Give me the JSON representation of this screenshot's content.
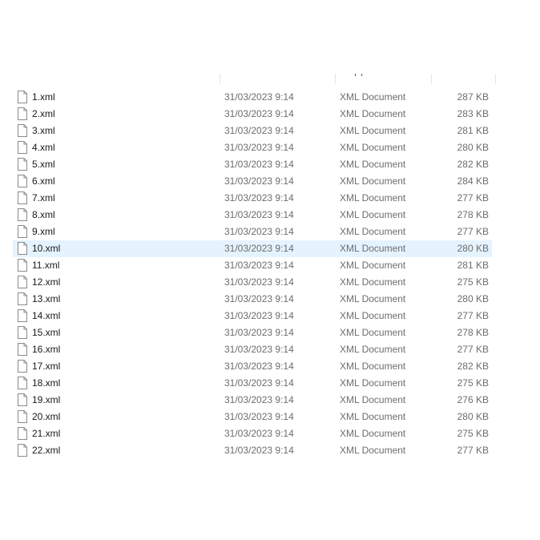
{
  "header": {
    "type_fragment": "ı ı"
  },
  "files": [
    {
      "name": "1.xml",
      "date": "31/03/2023 9:14",
      "type": "XML Document",
      "size": "287 KB",
      "selected": false
    },
    {
      "name": "2.xml",
      "date": "31/03/2023 9:14",
      "type": "XML Document",
      "size": "283 KB",
      "selected": false
    },
    {
      "name": "3.xml",
      "date": "31/03/2023 9:14",
      "type": "XML Document",
      "size": "281 KB",
      "selected": false
    },
    {
      "name": "4.xml",
      "date": "31/03/2023 9:14",
      "type": "XML Document",
      "size": "280 KB",
      "selected": false
    },
    {
      "name": "5.xml",
      "date": "31/03/2023 9:14",
      "type": "XML Document",
      "size": "282 KB",
      "selected": false
    },
    {
      "name": "6.xml",
      "date": "31/03/2023 9:14",
      "type": "XML Document",
      "size": "284 KB",
      "selected": false
    },
    {
      "name": "7.xml",
      "date": "31/03/2023 9:14",
      "type": "XML Document",
      "size": "277 KB",
      "selected": false
    },
    {
      "name": "8.xml",
      "date": "31/03/2023 9:14",
      "type": "XML Document",
      "size": "278 KB",
      "selected": false
    },
    {
      "name": "9.xml",
      "date": "31/03/2023 9:14",
      "type": "XML Document",
      "size": "277 KB",
      "selected": false
    },
    {
      "name": "10.xml",
      "date": "31/03/2023 9:14",
      "type": "XML Document",
      "size": "280 KB",
      "selected": true
    },
    {
      "name": "11.xml",
      "date": "31/03/2023 9:14",
      "type": "XML Document",
      "size": "281 KB",
      "selected": false
    },
    {
      "name": "12.xml",
      "date": "31/03/2023 9:14",
      "type": "XML Document",
      "size": "275 KB",
      "selected": false
    },
    {
      "name": "13.xml",
      "date": "31/03/2023 9:14",
      "type": "XML Document",
      "size": "280 KB",
      "selected": false
    },
    {
      "name": "14.xml",
      "date": "31/03/2023 9:14",
      "type": "XML Document",
      "size": "277 KB",
      "selected": false
    },
    {
      "name": "15.xml",
      "date": "31/03/2023 9:14",
      "type": "XML Document",
      "size": "278 KB",
      "selected": false
    },
    {
      "name": "16.xml",
      "date": "31/03/2023 9:14",
      "type": "XML Document",
      "size": "277 KB",
      "selected": false
    },
    {
      "name": "17.xml",
      "date": "31/03/2023 9:14",
      "type": "XML Document",
      "size": "282 KB",
      "selected": false
    },
    {
      "name": "18.xml",
      "date": "31/03/2023 9:14",
      "type": "XML Document",
      "size": "275 KB",
      "selected": false
    },
    {
      "name": "19.xml",
      "date": "31/03/2023 9:14",
      "type": "XML Document",
      "size": "276 KB",
      "selected": false
    },
    {
      "name": "20.xml",
      "date": "31/03/2023 9:14",
      "type": "XML Document",
      "size": "280 KB",
      "selected": false
    },
    {
      "name": "21.xml",
      "date": "31/03/2023 9:14",
      "type": "XML Document",
      "size": "275 KB",
      "selected": false
    },
    {
      "name": "22.xml",
      "date": "31/03/2023 9:14",
      "type": "XML Document",
      "size": "277 KB",
      "selected": false
    }
  ],
  "icons": {
    "file": "xml-document-icon"
  },
  "colors": {
    "selected_row": "#e5f3ff",
    "secondary_text": "#6d6d6d",
    "primary_text": "#1a1a1a"
  }
}
